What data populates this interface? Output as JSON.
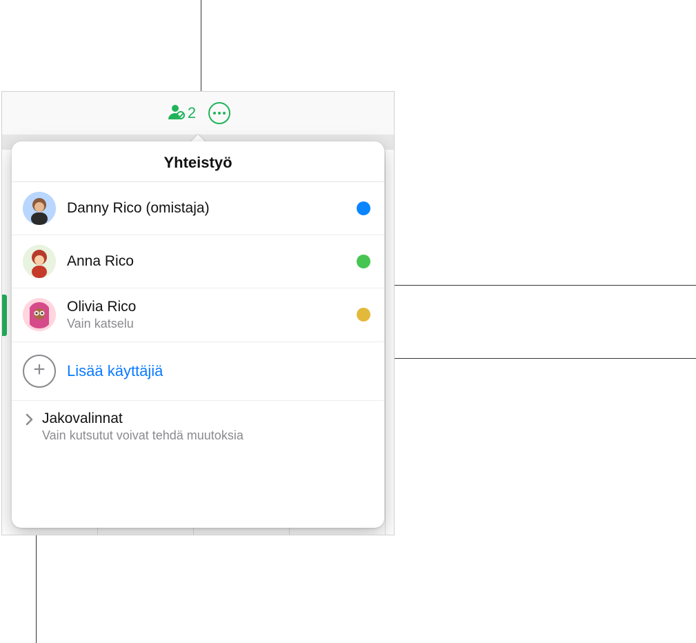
{
  "toolbar": {
    "collab_count": "2"
  },
  "popover": {
    "title": "Yhteistyö",
    "participants": [
      {
        "name": "Danny Rico (omistaja)",
        "sub": "",
        "avatar_bg": "av-blue",
        "status": "sd-blue"
      },
      {
        "name": "Anna Rico",
        "sub": "",
        "avatar_bg": "av-green",
        "status": "sd-green"
      },
      {
        "name": "Olivia Rico",
        "sub": "Vain katselu",
        "avatar_bg": "av-pink",
        "status": "sd-yellow"
      }
    ],
    "add_label": "Lisää käyttäjiä",
    "options": {
      "title": "Jakovalinnat",
      "sub": "Vain kutsutut voivat tehdä muutoksia"
    }
  }
}
